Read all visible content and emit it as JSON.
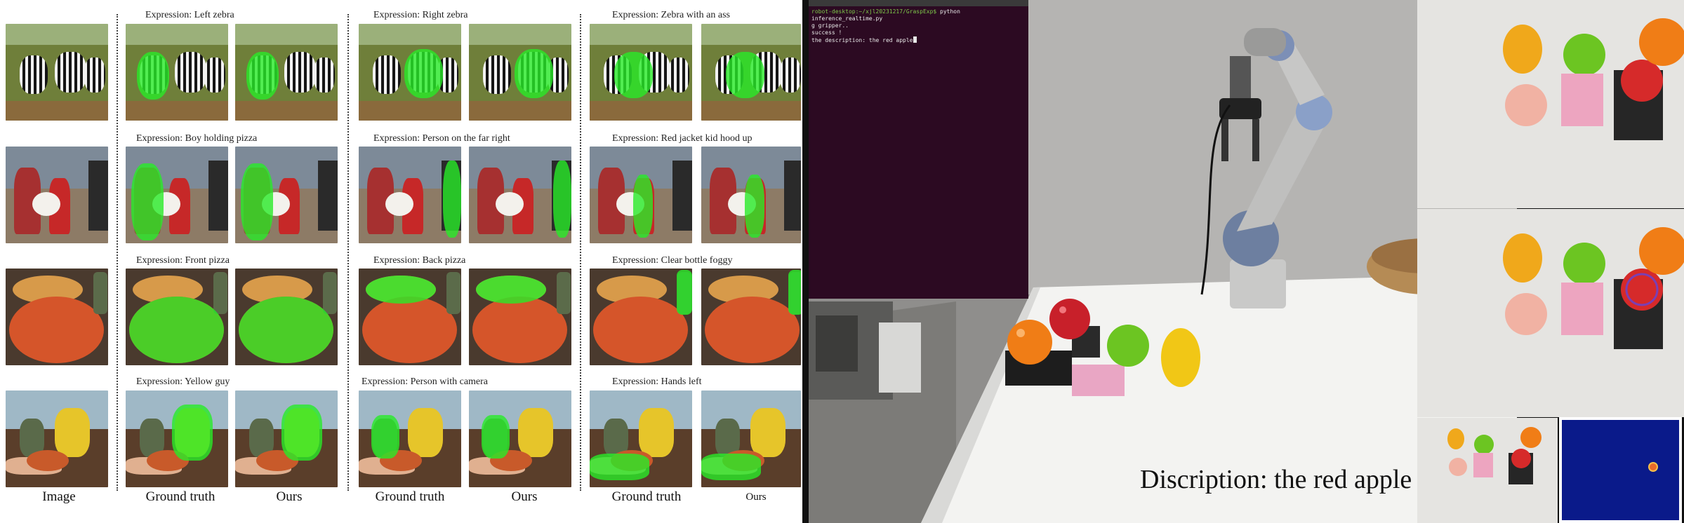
{
  "figure": {
    "row_labels": [
      {
        "col2": "Expression: Left zebra",
        "col3": "Expression: Right zebra",
        "col4": "Expression: Zebra with an ass"
      },
      {
        "col2": "Expression: Boy holding pizza",
        "col3": "Expression: Person on the far right",
        "col4": "Expression: Red jacket kid hood up"
      },
      {
        "col2": "Expression: Front pizza",
        "col3": "Expression: Back pizza",
        "col4": "Expression: Clear bottle foggy"
      },
      {
        "col2": "Expression: Yellow guy",
        "col3": "Expression: Person with camera",
        "col4": "Expression: Hands left"
      }
    ],
    "column_labels": [
      "Image",
      "Ground truth",
      "Ours",
      "Ground truth",
      "Ours",
      "Ground truth",
      "Ours"
    ]
  },
  "terminal": {
    "line1_user": "robot-desktop:~/xjl20231217/GraspExp$",
    "line1_cmd": " python inference_realtime.py",
    "line2": "g gripper..",
    "line3": " success !",
    "line4": "the description: the red apple"
  },
  "video": {
    "caption": "Discription: the red apple"
  },
  "colors": {
    "mask_green": "#28eb28",
    "terminal_bg": "#2c0a22",
    "minimap_bg": "#0a1a8a",
    "target_dot": "#e86a2a"
  }
}
